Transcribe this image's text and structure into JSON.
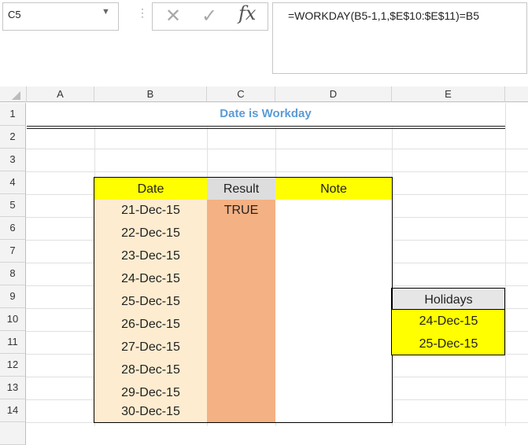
{
  "formula_bar": {
    "name_box": "C5",
    "cancel_icon": "✕",
    "enter_icon": "✓",
    "fx_icon": "fx",
    "separator": "⋮",
    "formula": "=WORKDAY(B5-1,1,$E$10:$E$11)=B5"
  },
  "columns": [
    "A",
    "B",
    "C",
    "D",
    "E"
  ],
  "rows": [
    "1",
    "2",
    "3",
    "4",
    "5",
    "6",
    "7",
    "8",
    "9",
    "10",
    "11",
    "12",
    "13",
    "14"
  ],
  "sheet": {
    "title": "Date is Workday",
    "table_headers": {
      "date": "Date",
      "result": "Result",
      "note": "Note"
    },
    "dates": [
      "21-Dec-15",
      "22-Dec-15",
      "23-Dec-15",
      "24-Dec-15",
      "25-Dec-15",
      "26-Dec-15",
      "27-Dec-15",
      "28-Dec-15",
      "29-Dec-15",
      "30-Dec-15"
    ],
    "results": [
      "TRUE",
      "",
      "",
      "",
      "",
      "",
      "",
      "",
      "",
      ""
    ],
    "holidays_header": "Holidays",
    "holidays": [
      "24-Dec-15",
      "25-Dec-15"
    ]
  },
  "colors": {
    "title": "#5b9bd5",
    "header_yellow": "#ffff00",
    "result_header": "#dddddd",
    "date_fill": "#fdecd0",
    "result_fill": "#f4b183"
  }
}
